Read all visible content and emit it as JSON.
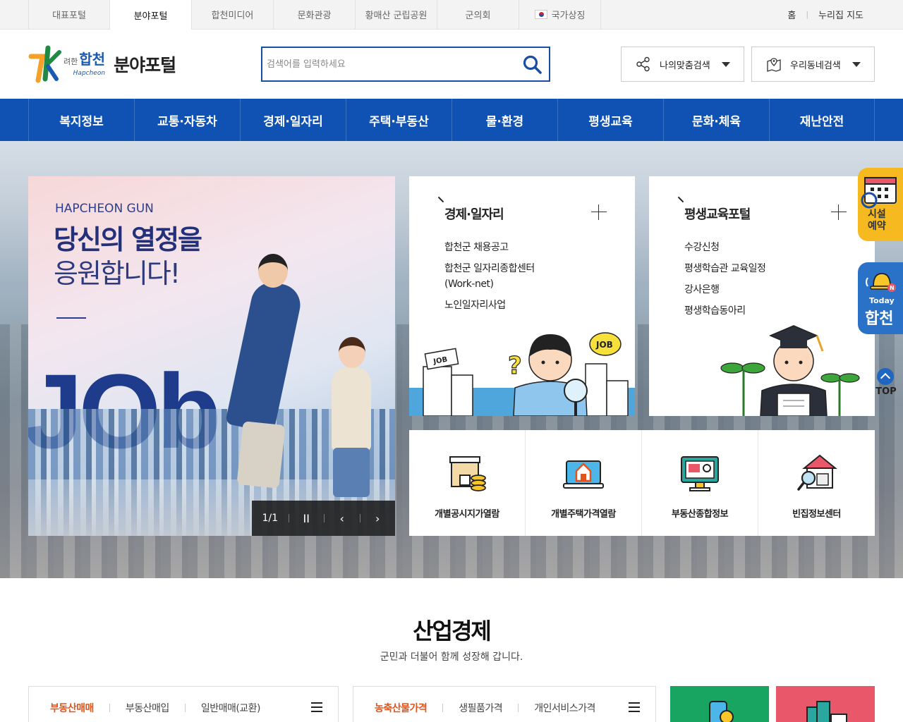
{
  "topbar": {
    "tabs": [
      {
        "label": "대표포털"
      },
      {
        "label": "분야포털"
      },
      {
        "label": "합천미디어"
      },
      {
        "label": "문화관광"
      },
      {
        "label": "황매산 군립공원"
      },
      {
        "label": "군의회"
      },
      {
        "label": "국가상징"
      }
    ],
    "links": {
      "home": "홈",
      "sitemap": "누리집 지도"
    }
  },
  "header": {
    "logo": {
      "mark": "K",
      "small": "려한",
      "city": "합천",
      "en": "Hapcheon",
      "title": "분야포털"
    },
    "search": {
      "placeholder": "검색어를 입력하세요",
      "value": ""
    },
    "btn_custom": "나의맞춤검색",
    "btn_town": "우리동네검색"
  },
  "gnb": [
    {
      "label": "복지정보"
    },
    {
      "label": "교통·자동차"
    },
    {
      "label": "경제·일자리"
    },
    {
      "label": "주택·부동산"
    },
    {
      "label": "물·환경"
    },
    {
      "label": "평생교육"
    },
    {
      "label": "문화·체육"
    },
    {
      "label": "재난안전"
    }
  ],
  "banner": {
    "en": "HAPCHEON GUN",
    "line1": "당신의 열정을",
    "line2": "응원합니다!",
    "big": "JOb",
    "counter": "1/1",
    "pause": "II",
    "prev": "‹",
    "next": "›"
  },
  "card_economy": {
    "title": "경제·일자리",
    "items": [
      "합천군 채용공고",
      "합천군 일자리종합센터",
      "(Work-net)",
      "노인일자리사업"
    ],
    "job_label": "JOB"
  },
  "card_edu": {
    "title": "평생교육포털",
    "items": [
      "수강신청",
      "평생학습관 교육일정",
      "강사은행",
      "평생학습동아리"
    ]
  },
  "quick": [
    {
      "label": "개별공시지가열람",
      "icon": "land-price-icon"
    },
    {
      "label": "개별주택가격열람",
      "icon": "house-price-icon"
    },
    {
      "label": "부동산종합정보",
      "icon": "real-estate-icon"
    },
    {
      "label": "빈집정보센터",
      "icon": "empty-house-icon"
    }
  ],
  "floating": {
    "reservation": {
      "line1": "시설",
      "line2": "예약"
    },
    "today": {
      "line1": "Today",
      "line2": "합천"
    },
    "top": "TOP"
  },
  "section": {
    "title": "산업경제",
    "subtitle": "군민과 더불어 함께 성장해 갑니다."
  },
  "tabs_realestate": [
    "부동산매매",
    "부동산매입",
    "일반매매(교환)"
  ],
  "tabs_price": [
    "농축산물가격",
    "생필품가격",
    "개인서비스가격"
  ],
  "colors": {
    "brand_blue": "#0f52b3",
    "accent_orange": "#e2541b",
    "tile_green": "#17a561",
    "tile_pink": "#e9576b",
    "float_yellow": "#f6b91f"
  }
}
